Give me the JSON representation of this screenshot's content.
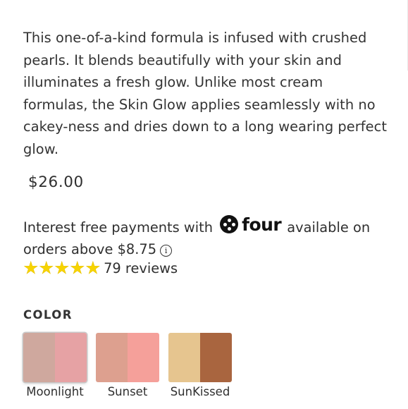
{
  "product": {
    "description": "This one-of-a-kind formula is infused with crushed pearls. It blends beautifully with your skin and illuminates a fresh glow. Unlike most cream formulas, the Skin Glow applies seamlessly with no cakey-ness and dries down to a long wearing perfect glow.",
    "price": "$26.00"
  },
  "payments": {
    "prefix": "Interest free payments with",
    "brand": "four",
    "suffix": "available on",
    "line2": "orders above $8.75",
    "info_icon": "ⓘ"
  },
  "rating": {
    "stars": 5,
    "star_glyph": "★",
    "star_color": "#F7D400",
    "reviews_text": "79 reviews"
  },
  "color": {
    "label": "COLOR",
    "selected": "Moonlight",
    "swatches": [
      {
        "name": "Moonlight",
        "colors": [
          "#CFA89E",
          "#E6A2A4"
        ]
      },
      {
        "name": "Sunset",
        "colors": [
          "#DDA08F",
          "#F5A09A"
        ]
      },
      {
        "name": "SunKissed",
        "colors": [
          "#E6C58F",
          "#A9653F"
        ]
      }
    ]
  }
}
